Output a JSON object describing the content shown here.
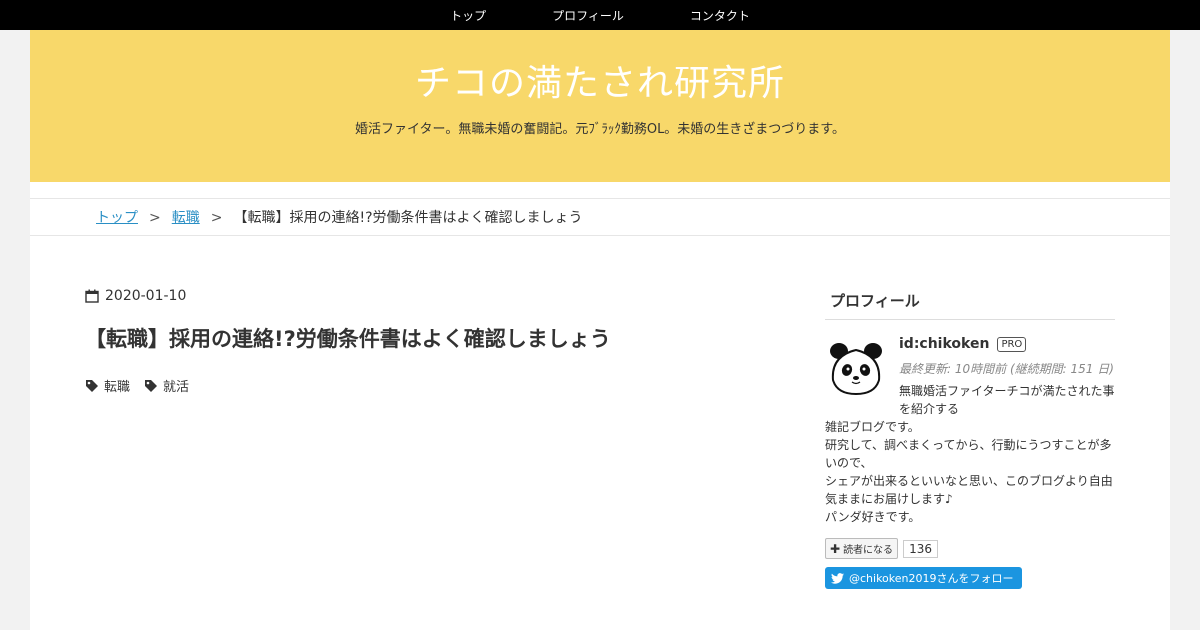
{
  "nav": {
    "items": [
      "トップ",
      "プロフィール",
      "コンタクト"
    ]
  },
  "header": {
    "title": "チコの満たされ研究所",
    "description": "婚活ファイター。無職未婚の奮闘記。元ﾌﾞﾗｯｸ勤務OL。未婚の生きざまつづります。"
  },
  "breadcrumb": {
    "home": "トップ",
    "category": "転職",
    "separator": ">",
    "current": "【転職】採用の連絡!?労働条件書はよく確認しましょう"
  },
  "entry": {
    "date": "2020-01-10",
    "title": "【転職】採用の連絡!?労働条件書はよく確認しましょう",
    "categories": [
      "転職",
      "就活"
    ]
  },
  "sidebar": {
    "heading": "プロフィール",
    "profile_id": "id:chikoken",
    "pro_badge": "PRO",
    "updated": "最終更新: 10時間前 (継続期間: 151 日)",
    "desc_short": "無職婚活ファイターチコが満たされた事を紹介する",
    "desc_lines": [
      "雑記ブログです。",
      "研究して、調べまくってから、行動にうつすことが多いので、",
      "シェアが出来るといいなと思い、このブログより自由気ままにお届けします♪",
      "パンダ好きです。"
    ],
    "reader_button": "読者になる",
    "reader_count": "136",
    "twitter_button": "@chikoken2019さんをフォロー"
  },
  "colors": {
    "header_bg": "#f8d86a",
    "link": "#2a8fc5",
    "twitter": "#1b95e0"
  }
}
